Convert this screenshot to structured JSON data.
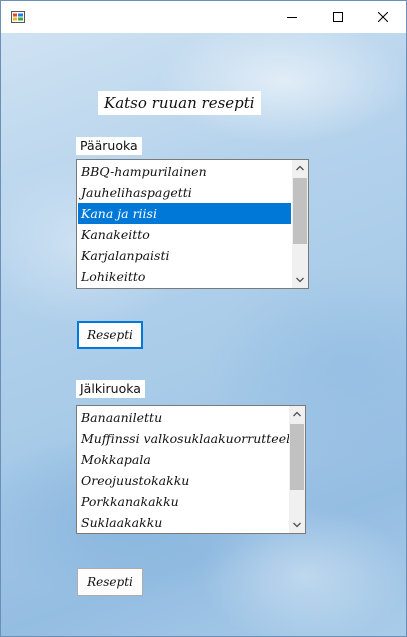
{
  "window": {
    "title": ""
  },
  "header": {
    "title": "Katso ruuan resepti"
  },
  "main_course": {
    "label": "Pääruoka",
    "items": [
      "BBQ-hampurilainen",
      "Jauhelihaspagetti",
      "Kana ja riisi",
      "Kanakeitto",
      "Karjalanpaisti",
      "Lohikeitto"
    ],
    "selected": "Kana ja riisi",
    "button_label": "Resepti"
  },
  "dessert": {
    "label": "Jälkiruoka",
    "items": [
      "Banaanilettu",
      "Muffinssi valkosuklaakuorrutteella",
      "Mokkapala",
      "Oreojuustokakku",
      "Porkkanakakku",
      "Suklaakakku"
    ],
    "button_label": "Resepti"
  },
  "colors": {
    "selection": "#0078d7",
    "background": "#b4d2ec"
  }
}
